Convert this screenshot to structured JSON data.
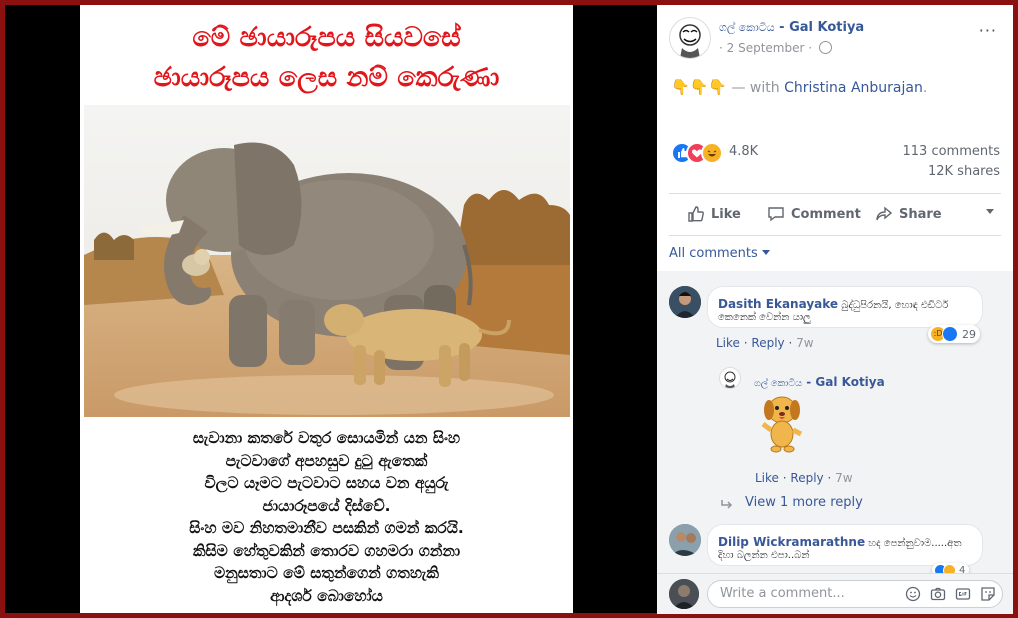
{
  "image_post": {
    "title_line1": "මේ ඡායාරූපය සියවසේ",
    "title_line2": "ඡායාරූපය ලෙස නම් කෙරුණා",
    "caption_lines": [
      "සැවානා කතරේ වතුර සොයමින් යන සිංහ",
      "පැටවාගේ අපහසුව දුටු ඇතෙක්",
      "විලට යෑමට පැටවාට සහය වන අයුරු",
      "ජායාරූපයේ දිස්වේ.",
      "සිංහ මව නිහතමානීව පසකින් ගමන් කරයි.",
      "කිසිම හේතුවකින් තොරව ගහමරා ගන්නා",
      "මනුසතාට මේ සතුන්ගෙන් ගතහැකි",
      "ආදර්ශ බොහෝය"
    ]
  },
  "post": {
    "page_name_sinhala": "ගල් කොටිය",
    "page_name_separator": " - ",
    "page_name": "Gal Kotiya",
    "date": "2 September",
    "date_separator": "·",
    "more_icon": "···",
    "text_emoji": "👇👇👇",
    "text_with": " — with ",
    "tagged_person": "Christina Anburajan",
    "text_end": ".",
    "reaction_count": "4.8K",
    "comments_count": "113 comments",
    "shares_count": "12K shares"
  },
  "actions": {
    "like": "Like",
    "comment": "Comment",
    "share": "Share"
  },
  "comments_filter": "All comments",
  "comments": [
    {
      "author": "Dasith Ekanayake",
      "text_line1": " බුද්ධුපිරනයි, හොඳ එඩිටර්",
      "text_line2": "කෙනෙක් වෙන්න යාලු",
      "like": "Like",
      "reply": "Reply",
      "time": "7w",
      "reaction_count": "29"
    },
    {
      "author_sinhala": "ගල් කොටිය",
      "author": "Gal Kotiya",
      "separator": " - ",
      "like": "Like",
      "reply": "Reply",
      "time": "7w"
    },
    {
      "author": "Dilip Wickramarathne",
      "text_line1": " හද පෙන්නුවාම.....අත",
      "text_line2": "දිහා බලන්න එපා..බන්",
      "reaction_count": "4"
    }
  ],
  "view_more": "View 1 more reply",
  "composer": {
    "placeholder": "Write a comment..."
  },
  "colors": {
    "link": "#365899",
    "title_red": "#e2151a",
    "frame": "#8b1010"
  }
}
